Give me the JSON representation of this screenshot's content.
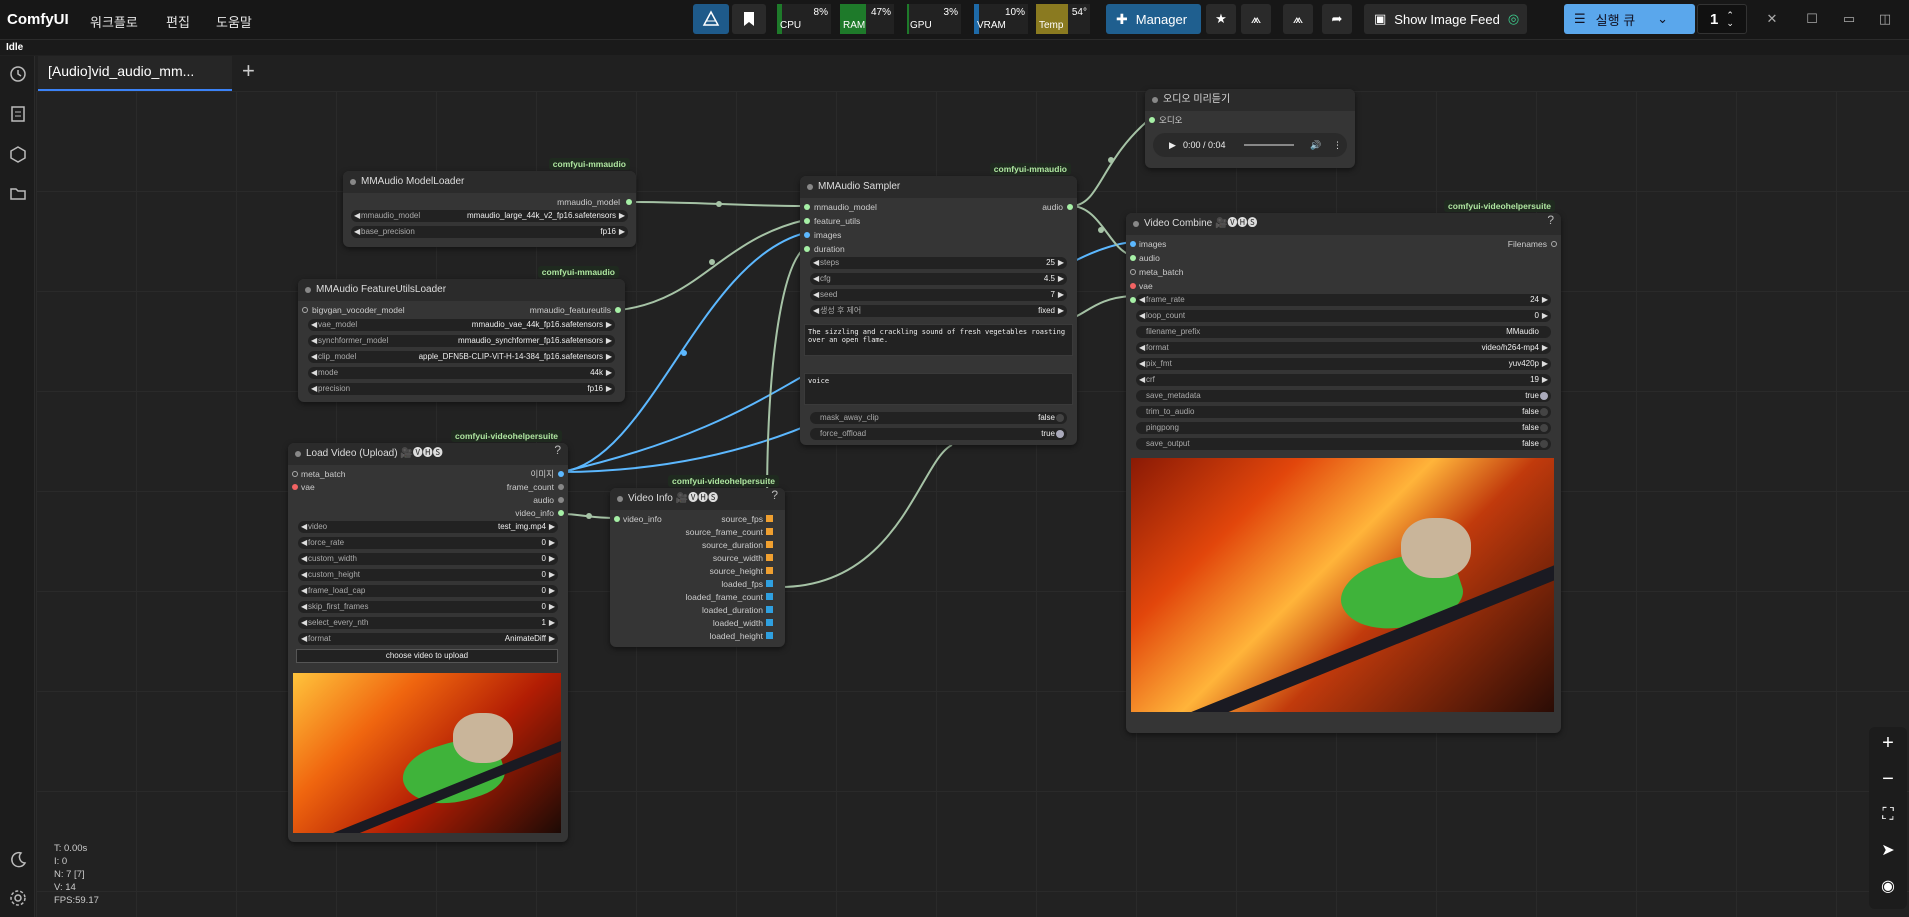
{
  "app": {
    "brand": "ComfyUI",
    "menus": [
      "워크플로",
      "편집",
      "도움말"
    ],
    "status": "Idle"
  },
  "toolbar": {
    "meters": [
      {
        "label": "CPU",
        "value": "8%",
        "color": "#1e7a2a",
        "level": 0.08
      },
      {
        "label": "RAM",
        "value": "47%",
        "color": "#1e7a2a",
        "level": 0.47
      },
      {
        "label": "GPU",
        "value": "3%",
        "color": "#1e7a2a",
        "level": 0.03
      },
      {
        "label": "VRAM",
        "value": "10%",
        "color": "#1e7a2a",
        "level": 0.1
      },
      {
        "label": "Temp",
        "value": "54°",
        "color": "#8a7a20",
        "level": 0.54
      }
    ],
    "manager_label": "Manager",
    "image_feed_label": "Show Image Feed",
    "queue_label": "실행 큐",
    "queue_count": "1"
  },
  "tab": {
    "label": "[Audio]vid_audio_mm..."
  },
  "nodes": {
    "modelloader": {
      "title": "MMAudio ModelLoader",
      "badge": "comfyui-mmaudio",
      "output": "mmaudio_model",
      "widgets": [
        {
          "label": "mmaudio_model",
          "value": "mmaudio_large_44k_v2_fp16.safetensors"
        },
        {
          "label": "base_precision",
          "value": "fp16"
        }
      ]
    },
    "featureloader": {
      "title": "MMAudio FeatureUtilsLoader",
      "badge": "comfyui-mmaudio",
      "input": "bigvgan_vocoder_model",
      "output": "mmaudio_featureutils",
      "widgets": [
        {
          "label": "vae_model",
          "value": "mmaudio_vae_44k_fp16.safetensors"
        },
        {
          "label": "synchformer_model",
          "value": "mmaudio_synchformer_fp16.safetensors"
        },
        {
          "label": "clip_model",
          "value": "apple_DFN5B-CLIP-ViT-H-14-384_fp16.safetensors"
        },
        {
          "label": "mode",
          "value": "44k"
        },
        {
          "label": "precision",
          "value": "fp16"
        }
      ]
    },
    "sampler": {
      "title": "MMAudio Sampler",
      "badge": "comfyui-mmaudio",
      "inputs": [
        "mmaudio_model",
        "feature_utils",
        "images",
        "duration"
      ],
      "output": "audio",
      "widgets": [
        {
          "label": "steps",
          "value": "25"
        },
        {
          "label": "cfg",
          "value": "4.5"
        },
        {
          "label": "seed",
          "value": "7"
        },
        {
          "label": "생성 후 제어",
          "value": "fixed"
        }
      ],
      "prompt": "The sizzling and crackling sound of fresh vegetables roasting over an open flame.",
      "negative": "voice",
      "toggles": [
        {
          "label": "mask_away_clip",
          "value": "false"
        },
        {
          "label": "force_offload",
          "value": "true"
        }
      ]
    },
    "audiopreview": {
      "title": "오디오 미리듣기",
      "input": "오디오",
      "time": "0:00 / 0:04"
    },
    "videocombine": {
      "title": "Video Combine 🎥🅥🅗🅢",
      "badge": "comfyui-videohelpersuite",
      "inputs": [
        "images",
        "audio",
        "meta_batch",
        "vae"
      ],
      "output": "Filenames",
      "widgets": [
        {
          "label": "frame_rate",
          "value": "24"
        },
        {
          "label": "loop_count",
          "value": "0"
        },
        {
          "label": "filename_prefix",
          "value": "MMaudio"
        },
        {
          "label": "format",
          "value": "video/h264-mp4"
        },
        {
          "label": "pix_fmt",
          "value": "yuv420p"
        },
        {
          "label": "crf",
          "value": "19"
        }
      ],
      "toggles": [
        {
          "label": "save_metadata",
          "value": "true"
        },
        {
          "label": "trim_to_audio",
          "value": "false"
        },
        {
          "label": "pingpong",
          "value": "false"
        },
        {
          "label": "save_output",
          "value": "false"
        }
      ]
    },
    "loadvideo": {
      "title": "Load Video (Upload) 🎥🅥🅗🅢",
      "badge": "comfyui-videohelpersuite",
      "inputs": [
        "meta_batch",
        "vae"
      ],
      "outputs": [
        "이미지",
        "frame_count",
        "audio",
        "video_info"
      ],
      "widgets": [
        {
          "label": "video",
          "value": "test_img.mp4"
        },
        {
          "label": "force_rate",
          "value": "0"
        },
        {
          "label": "custom_width",
          "value": "0"
        },
        {
          "label": "custom_height",
          "value": "0"
        },
        {
          "label": "frame_load_cap",
          "value": "0"
        },
        {
          "label": "skip_first_frames",
          "value": "0"
        },
        {
          "label": "select_every_nth",
          "value": "1"
        },
        {
          "label": "format",
          "value": "AnimateDiff"
        }
      ],
      "upload_label": "choose video to upload"
    },
    "videoinfo": {
      "title": "Video Info 🎥🅥🅗🅢",
      "badge": "comfyui-videohelpersuite",
      "input": "video_info",
      "outputs": [
        "source_fps",
        "source_frame_count",
        "source_duration",
        "source_width",
        "source_height",
        "loaded_fps",
        "loaded_frame_count",
        "loaded_duration",
        "loaded_width",
        "loaded_height"
      ]
    }
  },
  "stats": {
    "t": "T: 0.00s",
    "i": "I: 0",
    "n": "N: 7 [7]",
    "v": "V: 14",
    "fps": "FPS:59.17"
  }
}
